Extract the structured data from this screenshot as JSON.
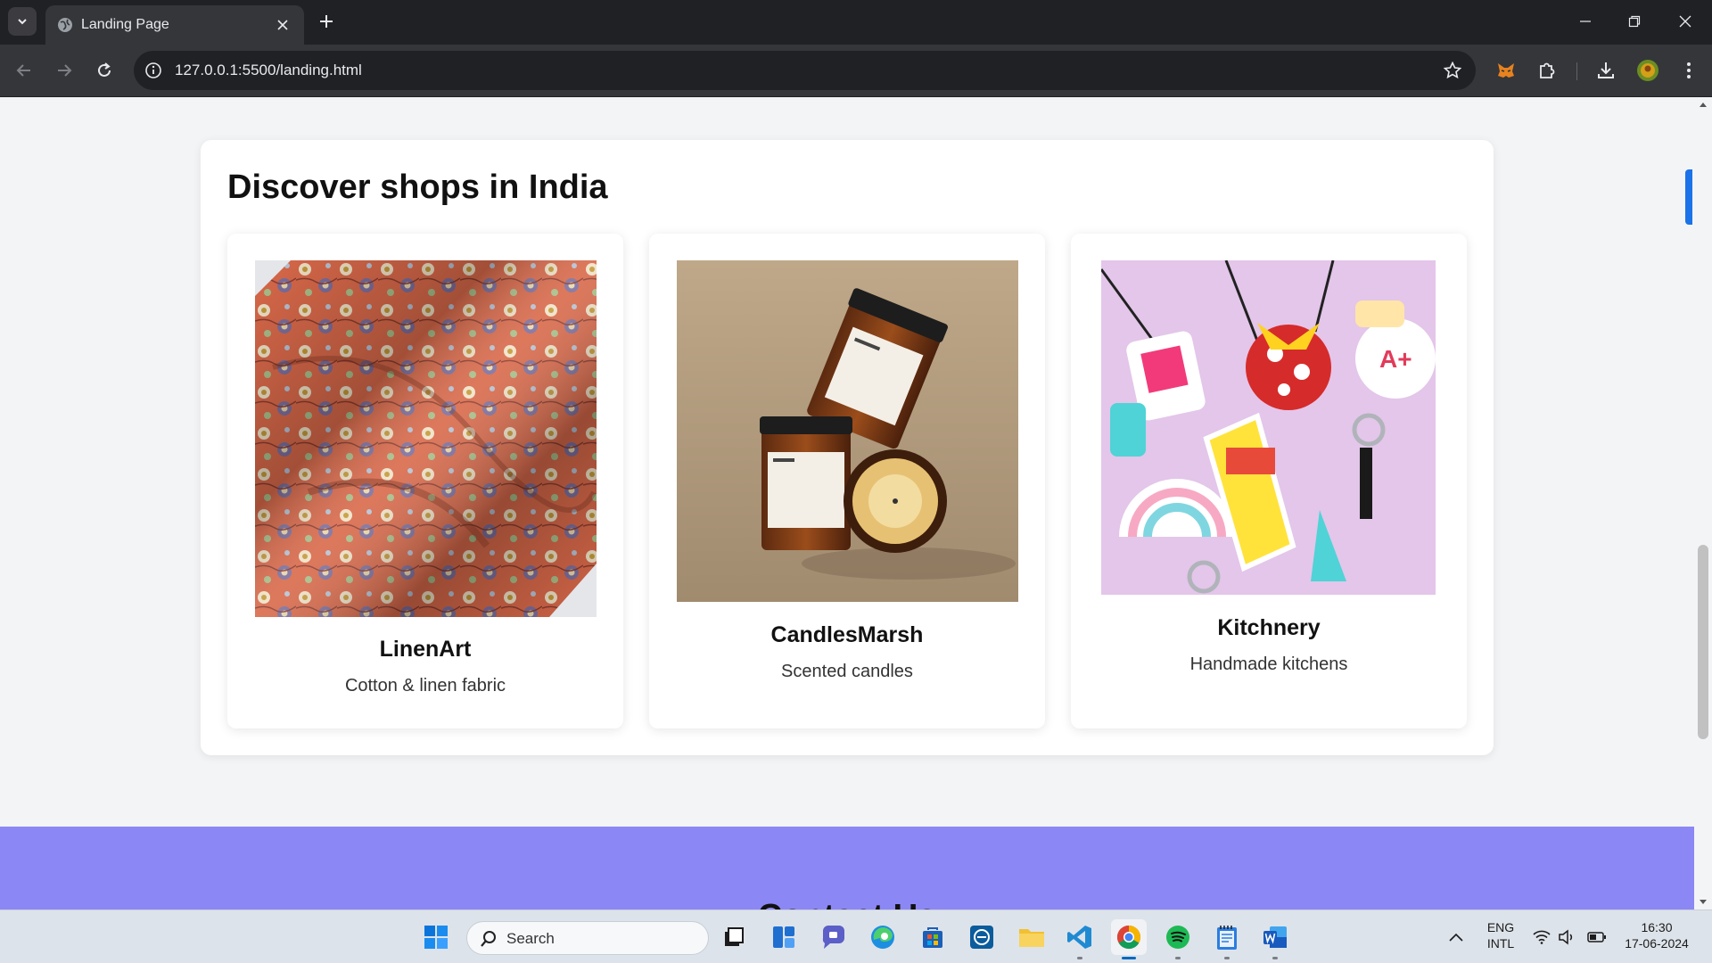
{
  "browser": {
    "tab_title": "Landing Page",
    "url": "127.0.0.1:5500/landing.html"
  },
  "section": {
    "title": "Discover shops in India",
    "cards": [
      {
        "name": "LinenArt",
        "description": "Cotton & linen fabric"
      },
      {
        "name": "CandlesMarsh",
        "description": "Scented candles"
      },
      {
        "name": "Kitchnery",
        "description": "Handmade kitchens"
      }
    ]
  },
  "contact": {
    "heading": "Contact Us"
  },
  "taskbar": {
    "search_label": "Search",
    "lang_line1": "ENG",
    "lang_line2": "INTL",
    "time": "16:30",
    "date": "17-06-2024"
  },
  "colors": {
    "contact_bg": "#8b87f5",
    "page_bg": "#f3f4f6",
    "chrome_dark": "#202124",
    "accent_blue": "#1a73e8"
  },
  "icons": [
    "chevron-down-icon",
    "globe-icon",
    "close-icon",
    "plus-icon",
    "minimize-icon",
    "restore-icon",
    "back-icon",
    "forward-icon",
    "reload-icon",
    "info-icon",
    "star-icon",
    "metamask-icon",
    "extensions-icon",
    "download-icon",
    "profile-icon",
    "kebab-menu-icon",
    "windows-start-icon",
    "search-icon",
    "wifi-icon",
    "volume-icon",
    "battery-icon"
  ]
}
